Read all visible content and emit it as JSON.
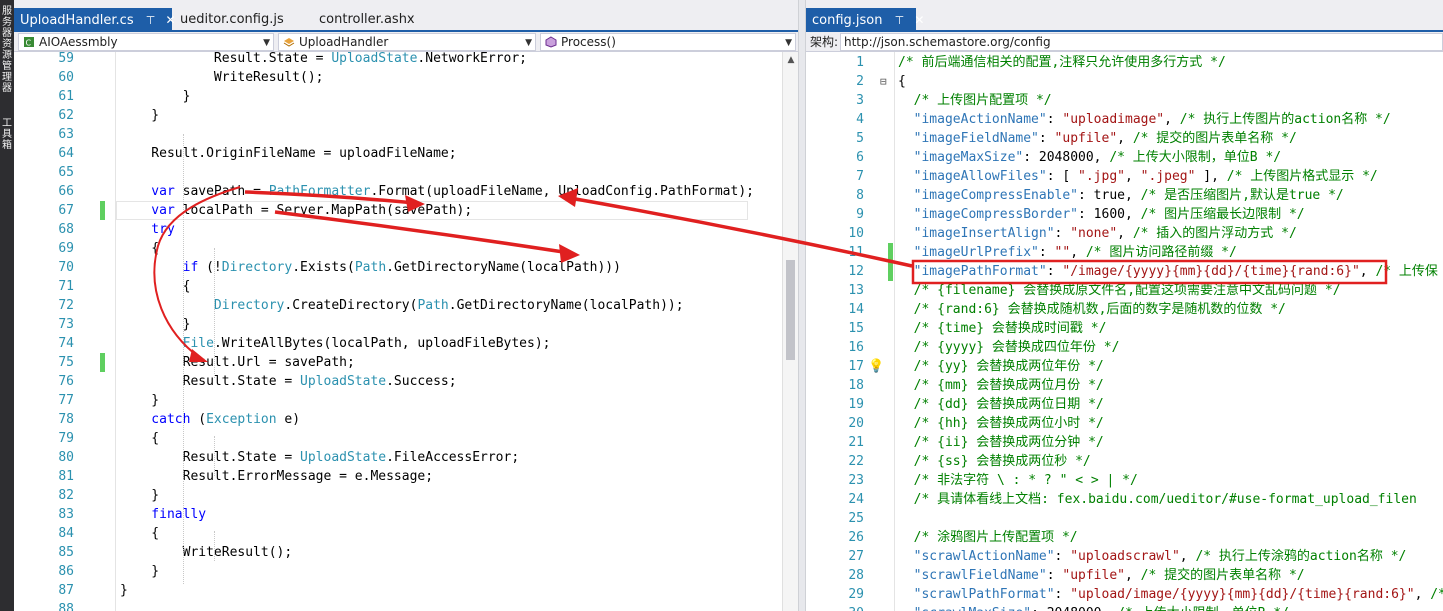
{
  "left_strip": {
    "labels": [
      "服务器资源管理器",
      "工具箱"
    ]
  },
  "left_pane": {
    "tabs": [
      {
        "label": "UploadHandler.cs",
        "pin": "⊤",
        "close": "✕",
        "active": true
      },
      {
        "label": "ueditor.config.js",
        "active": false
      },
      {
        "label": "controller.ashx",
        "active": false
      }
    ],
    "nav": {
      "project": "AIOAessmbly",
      "class": "UploadHandler",
      "member": "Process()"
    },
    "lines": [
      {
        "n": "59",
        "code": [
          [
            "p",
            "            Result.State = "
          ],
          [
            "t",
            "UploadState"
          ],
          [
            "p",
            ".NetworkError;"
          ]
        ]
      },
      {
        "n": "60",
        "code": [
          [
            "p",
            "            WriteResult();"
          ]
        ]
      },
      {
        "n": "61",
        "code": [
          [
            "p",
            "        }"
          ]
        ]
      },
      {
        "n": "62",
        "code": [
          [
            "p",
            "    }"
          ]
        ]
      },
      {
        "n": "63",
        "code": []
      },
      {
        "n": "64",
        "code": [
          [
            "p",
            "    Result.OriginFileName = uploadFileName;"
          ]
        ]
      },
      {
        "n": "65",
        "code": []
      },
      {
        "n": "66",
        "code": [
          [
            "k",
            "    var"
          ],
          [
            "p",
            " savePath = "
          ],
          [
            "t",
            "PathFormatter"
          ],
          [
            "p",
            ".Format(uploadFileName, UploadConfig.PathFormat);"
          ]
        ]
      },
      {
        "n": "67",
        "code": [
          [
            "k",
            "    var"
          ],
          [
            "p",
            " localPath = Server.MapPath(savePath);"
          ]
        ],
        "changed": true,
        "current": true
      },
      {
        "n": "68",
        "code": [
          [
            "k",
            "    try"
          ]
        ]
      },
      {
        "n": "69",
        "code": [
          [
            "p",
            "    {"
          ]
        ]
      },
      {
        "n": "70",
        "code": [
          [
            "k",
            "        if"
          ],
          [
            "p",
            " (!"
          ],
          [
            "t",
            "Directory"
          ],
          [
            "p",
            ".Exists("
          ],
          [
            "t",
            "Path"
          ],
          [
            "p",
            ".GetDirectoryName(localPath)))"
          ]
        ]
      },
      {
        "n": "71",
        "code": [
          [
            "p",
            "        {"
          ]
        ]
      },
      {
        "n": "72",
        "code": [
          [
            "p",
            "            "
          ],
          [
            "t",
            "Directory"
          ],
          [
            "p",
            ".CreateDirectory("
          ],
          [
            "t",
            "Path"
          ],
          [
            "p",
            ".GetDirectoryName(localPath));"
          ]
        ]
      },
      {
        "n": "73",
        "code": [
          [
            "p",
            "        }"
          ]
        ]
      },
      {
        "n": "74",
        "code": [
          [
            "p",
            "        "
          ],
          [
            "t",
            "File"
          ],
          [
            "p",
            ".WriteAllBytes(localPath, uploadFileBytes);"
          ]
        ]
      },
      {
        "n": "75",
        "code": [
          [
            "p",
            "        Result.Url = savePath;"
          ]
        ],
        "changed": true
      },
      {
        "n": "76",
        "code": [
          [
            "p",
            "        Result.State = "
          ],
          [
            "t",
            "UploadState"
          ],
          [
            "p",
            ".Success;"
          ]
        ]
      },
      {
        "n": "77",
        "code": [
          [
            "p",
            "    }"
          ]
        ]
      },
      {
        "n": "78",
        "code": [
          [
            "k",
            "    catch"
          ],
          [
            "p",
            " ("
          ],
          [
            "t",
            "Exception"
          ],
          [
            "p",
            " e)"
          ]
        ]
      },
      {
        "n": "79",
        "code": [
          [
            "p",
            "    {"
          ]
        ]
      },
      {
        "n": "80",
        "code": [
          [
            "p",
            "        Result.State = "
          ],
          [
            "t",
            "UploadState"
          ],
          [
            "p",
            ".FileAccessError;"
          ]
        ]
      },
      {
        "n": "81",
        "code": [
          [
            "p",
            "        Result.ErrorMessage = e.Message;"
          ]
        ]
      },
      {
        "n": "82",
        "code": [
          [
            "p",
            "    }"
          ]
        ]
      },
      {
        "n": "83",
        "code": [
          [
            "k",
            "    finally"
          ]
        ]
      },
      {
        "n": "84",
        "code": [
          [
            "p",
            "    {"
          ]
        ]
      },
      {
        "n": "85",
        "code": [
          [
            "p",
            "        WriteResult();"
          ]
        ]
      },
      {
        "n": "86",
        "code": [
          [
            "p",
            "    }"
          ]
        ]
      },
      {
        "n": "87",
        "code": [
          [
            "p",
            "}"
          ]
        ]
      },
      {
        "n": "88",
        "code": []
      }
    ]
  },
  "right_pane": {
    "tabs": [
      {
        "label": "config.json",
        "pin": "⊤",
        "close": "✕",
        "active": true
      }
    ],
    "schema": {
      "label": "架构:",
      "value": "http://json.schemastore.org/config"
    },
    "lines": [
      {
        "n": "1",
        "code": [
          [
            "pc",
            "/* 前后端通信相关的配置,注释只允许使用多行方式 */"
          ]
        ]
      },
      {
        "n": "2",
        "code": [
          [
            "p",
            "{"
          ]
        ],
        "fold": true
      },
      {
        "n": "3",
        "code": [
          [
            "pc",
            "  /* 上传图片配置项 */"
          ]
        ]
      },
      {
        "n": "4",
        "code": [
          [
            "pk",
            "  \"imageActionName\""
          ],
          [
            "p",
            ": "
          ],
          [
            "ps",
            "\"uploadimage\""
          ],
          [
            "p",
            ", "
          ],
          [
            "pc",
            "/* 执行上传图片的action名称 */"
          ]
        ]
      },
      {
        "n": "5",
        "code": [
          [
            "pk",
            "  \"imageFieldName\""
          ],
          [
            "p",
            ": "
          ],
          [
            "ps",
            "\"upfile\""
          ],
          [
            "p",
            ", "
          ],
          [
            "pc",
            "/* 提交的图片表单名称 */"
          ]
        ]
      },
      {
        "n": "6",
        "code": [
          [
            "pk",
            "  \"imageMaxSize\""
          ],
          [
            "p",
            ": 2048000, "
          ],
          [
            "pc",
            "/* 上传大小限制，单位B */"
          ]
        ]
      },
      {
        "n": "7",
        "code": [
          [
            "pk",
            "  \"imageAllowFiles\""
          ],
          [
            "p",
            ": [ "
          ],
          [
            "ps",
            "\".jpg\""
          ],
          [
            "p",
            ", "
          ],
          [
            "ps",
            "\".jpeg\""
          ],
          [
            "p",
            " ], "
          ],
          [
            "pc",
            "/* 上传图片格式显示 */"
          ]
        ]
      },
      {
        "n": "8",
        "code": [
          [
            "pk",
            "  \"imageCompressEnable\""
          ],
          [
            "p",
            ": true, "
          ],
          [
            "pc",
            "/* 是否压缩图片,默认是true */"
          ]
        ]
      },
      {
        "n": "9",
        "code": [
          [
            "pk",
            "  \"imageCompressBorder\""
          ],
          [
            "p",
            ": 1600, "
          ],
          [
            "pc",
            "/* 图片压缩最长边限制 */"
          ]
        ]
      },
      {
        "n": "10",
        "code": [
          [
            "pk",
            "  \"imageInsertAlign\""
          ],
          [
            "p",
            ": "
          ],
          [
            "ps",
            "\"none\""
          ],
          [
            "p",
            ", "
          ],
          [
            "pc",
            "/* 插入的图片浮动方式 */"
          ]
        ]
      },
      {
        "n": "11",
        "code": [
          [
            "pk",
            "  \"imageUrlPrefix\""
          ],
          [
            "p",
            ": "
          ],
          [
            "ps",
            "\"\""
          ],
          [
            "p",
            ", "
          ],
          [
            "pc",
            "/* 图片访问路径前缀 */"
          ]
        ],
        "changed": true
      },
      {
        "n": "12",
        "code": [
          [
            "pk",
            "  \"imagePathFormat\""
          ],
          [
            "p",
            ": "
          ],
          [
            "ps",
            "\"/image/{yyyy}{mm}{dd}/{time}{rand:6}\""
          ],
          [
            "p",
            ", "
          ],
          [
            "pc",
            "/* 上传保"
          ]
        ],
        "changed": true
      },
      {
        "n": "13",
        "code": [
          [
            "pc",
            "  /* {filename} 会替换成原文件名,配置这项需要注意中文乱码问题 */"
          ]
        ]
      },
      {
        "n": "14",
        "code": [
          [
            "pc",
            "  /* {rand:6} 会替换成随机数,后面的数字是随机数的位数 */"
          ]
        ]
      },
      {
        "n": "15",
        "code": [
          [
            "pc",
            "  /* {time} 会替换成时间戳 */"
          ]
        ]
      },
      {
        "n": "16",
        "code": [
          [
            "pc",
            "  /* {yyyy} 会替换成四位年份 */"
          ]
        ]
      },
      {
        "n": "17",
        "code": [
          [
            "pc",
            "  /* {yy} 会替换成两位年份 */"
          ]
        ],
        "bulb": true
      },
      {
        "n": "18",
        "code": [
          [
            "pc",
            "  /* {mm} 会替换成两位月份 */"
          ]
        ]
      },
      {
        "n": "19",
        "code": [
          [
            "pc",
            "  /* {dd} 会替换成两位日期 */"
          ]
        ]
      },
      {
        "n": "20",
        "code": [
          [
            "pc",
            "  /* {hh} 会替换成两位小时 */"
          ]
        ]
      },
      {
        "n": "21",
        "code": [
          [
            "pc",
            "  /* {ii} 会替换成两位分钟 */"
          ]
        ]
      },
      {
        "n": "22",
        "code": [
          [
            "pc",
            "  /* {ss} 会替换成两位秒 */"
          ]
        ]
      },
      {
        "n": "23",
        "code": [
          [
            "pc",
            "  /* 非法字符 \\ : * ? \" < > | */"
          ]
        ]
      },
      {
        "n": "24",
        "code": [
          [
            "pc",
            "  /* 具请体看线上文档: fex.baidu.com/ueditor/#use-format_upload_filen"
          ]
        ]
      },
      {
        "n": "25",
        "code": []
      },
      {
        "n": "26",
        "code": [
          [
            "pc",
            "  /* 涂鸦图片上传配置项 */"
          ]
        ]
      },
      {
        "n": "27",
        "code": [
          [
            "pk",
            "  \"scrawlActionName\""
          ],
          [
            "p",
            ": "
          ],
          [
            "ps",
            "\"uploadscrawl\""
          ],
          [
            "p",
            ", "
          ],
          [
            "pc",
            "/* 执行上传涂鸦的action名称 */"
          ]
        ]
      },
      {
        "n": "28",
        "code": [
          [
            "pk",
            "  \"scrawlFieldName\""
          ],
          [
            "p",
            ": "
          ],
          [
            "ps",
            "\"upfile\""
          ],
          [
            "p",
            ", "
          ],
          [
            "pc",
            "/* 提交的图片表单名称 */"
          ]
        ]
      },
      {
        "n": "29",
        "code": [
          [
            "pk",
            "  \"scrawlPathFormat\""
          ],
          [
            "p",
            ": "
          ],
          [
            "ps",
            "\"upload/image/{yyyy}{mm}{dd}/{time}{rand:6}\""
          ],
          [
            "p",
            ", "
          ],
          [
            "pc",
            "/* 上"
          ]
        ]
      },
      {
        "n": "30",
        "code": [
          [
            "pk",
            "  \"scrawlMaxSize\""
          ],
          [
            "p",
            ": 2048000, "
          ],
          [
            "pc",
            "/* 上传大小限制，单位B */"
          ]
        ]
      }
    ]
  }
}
